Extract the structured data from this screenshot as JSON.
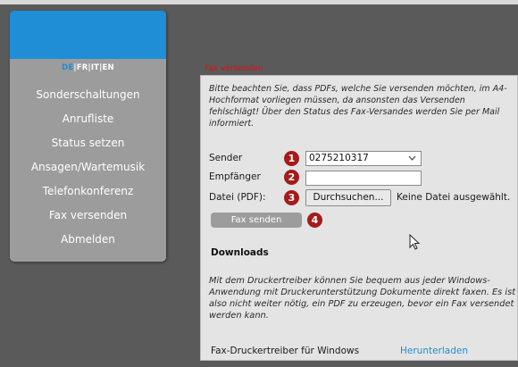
{
  "languages": [
    {
      "code": "DE",
      "active": true
    },
    {
      "code": "FR",
      "active": false
    },
    {
      "code": "IT",
      "active": false
    },
    {
      "code": "EN",
      "active": false
    }
  ],
  "sidebar": {
    "items": [
      {
        "label": "Sonderschaltungen"
      },
      {
        "label": "Anrufliste"
      },
      {
        "label": "Status setzen"
      },
      {
        "label": "Ansagen/Wartemusik"
      },
      {
        "label": "Telefonkonferenz"
      },
      {
        "label": "Fax versenden"
      },
      {
        "label": "Abmelden"
      }
    ]
  },
  "page": {
    "title": "Fax versenden",
    "notice": "Bitte beachten Sie, dass PDFs, welche Sie versenden möchten, im A4-Hochformat vorliegen müssen, da ansonsten das Versenden fehlschlägt! Über den Status des Fax-Versandes werden Sie per Mail informiert."
  },
  "form": {
    "sender_label": "Sender",
    "sender_value": "0275210317",
    "recipient_label": "Empfänger",
    "recipient_value": "",
    "file_label": "Datei (PDF):",
    "browse_label": "Durchsuchen...",
    "no_file_text": "Keine Datei ausgewählt.",
    "submit_label": "Fax senden",
    "markers": [
      "1",
      "2",
      "3",
      "4"
    ]
  },
  "downloads": {
    "heading": "Downloads",
    "text": "Mit dem Druckertreiber können Sie bequem aus jeder Windows-Anwendung mit Druckerunterstützung Dokumente direkt faxen. Es ist also nicht weiter nötig, ein PDF zu erzeugen, bevor ein Fax versendet werden kann.",
    "driver_label": "Fax-Druckertreiber für Windows",
    "download_link": "Herunterladen"
  },
  "colors": {
    "brand_blue": "#1f8ed6",
    "marker_red": "#a31b1b",
    "title_red": "#e01010",
    "sidebar_gray": "#9c9c9c",
    "background": "#5a5a5a"
  },
  "icons": {
    "select_arrow": "chevron-down-icon",
    "cursor": "mouse-pointer-icon"
  }
}
